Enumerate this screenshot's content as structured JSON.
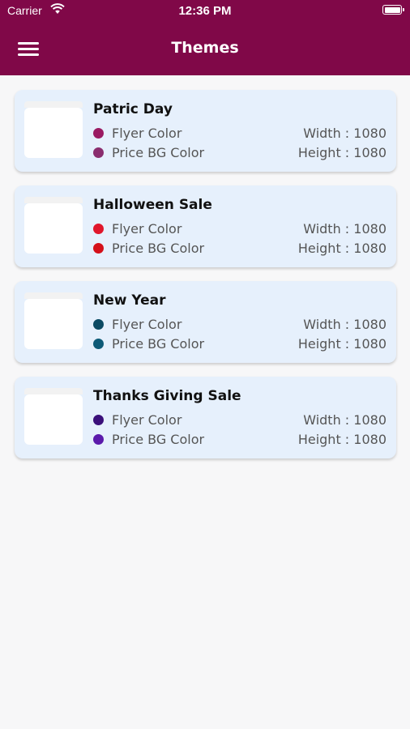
{
  "status_bar": {
    "carrier": "Carrier",
    "time": "12:36 PM"
  },
  "header": {
    "title": "Themes",
    "menu_icon": "hamburger-menu-icon"
  },
  "labels": {
    "flyer_color": "Flyer Color",
    "price_bg_color": "Price BG Color",
    "width_prefix": "Width : ",
    "height_prefix": "Height : "
  },
  "themes": [
    {
      "name": "Patric Day",
      "flyer_color": "#9a1a62",
      "price_bg_color": "#8a2d6e",
      "width": "1080",
      "height": "1080"
    },
    {
      "name": "Halloween Sale",
      "flyer_color": "#e0162b",
      "price_bg_color": "#d4101a",
      "width": "1080",
      "height": "1080"
    },
    {
      "name": "New Year",
      "flyer_color": "#0b4a63",
      "price_bg_color": "#0d5a77",
      "width": "1080",
      "height": "1080"
    },
    {
      "name": "Thanks Giving Sale",
      "flyer_color": "#3a0f7a",
      "price_bg_color": "#5b1aab",
      "width": "1080",
      "height": "1080"
    }
  ]
}
